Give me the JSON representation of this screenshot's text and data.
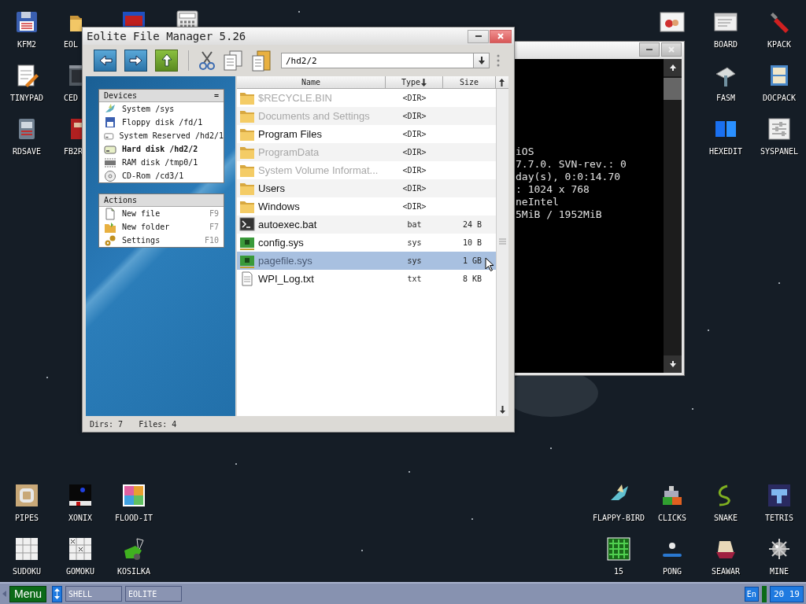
{
  "desktop": {
    "top_left": [
      [
        {
          "label": "KFM2"
        },
        {
          "label": "EOL"
        }
      ],
      [
        {
          "label": "TINYPAD"
        },
        {
          "label": "CED"
        }
      ],
      [
        {
          "label": "RDSAVE"
        },
        {
          "label": "FB2R"
        }
      ]
    ],
    "top_right": [
      [
        {
          "label": "BOARD"
        },
        {
          "label": "KPACK"
        }
      ],
      [
        {
          "label": "FASM"
        },
        {
          "label": "DOCPACK"
        }
      ],
      [
        {
          "label": "HEXEDIT"
        },
        {
          "label": "SYSPANEL"
        }
      ]
    ],
    "bottom_left": [
      [
        {
          "label": "PIPES"
        },
        {
          "label": "XONIX"
        },
        {
          "label": "FLOOD-IT"
        }
      ],
      [
        {
          "label": "SUDOKU"
        },
        {
          "label": "GOMOKU"
        },
        {
          "label": "KOSILKA"
        }
      ]
    ],
    "bottom_right": [
      [
        {
          "label": "FLAPPY-BIRD"
        },
        {
          "label": "CLICKS"
        },
        {
          "label": "SNAKE"
        },
        {
          "label": "TETRIS"
        }
      ],
      [
        {
          "label": "15"
        },
        {
          "label": "PONG"
        },
        {
          "label": "SEAWAR"
        },
        {
          "label": "MINE"
        }
      ]
    ]
  },
  "terminal": {
    "lines": [
      "iOS",
      "7.7.0. SVN-rev.: 0",
      "day(s), 0:0:14.70",
      ": 1024 x 768",
      "neIntel",
      "5MiB / 1952MiB"
    ]
  },
  "file_manager": {
    "title": "Eolite File Manager 5.26",
    "path": "/hd2/2",
    "devices": {
      "title": "Devices",
      "menu_symbol": "=",
      "items": [
        {
          "label": "System /sys",
          "selected": false
        },
        {
          "label": "Floppy disk /fd/1",
          "selected": false
        },
        {
          "label": "System Reserved /hd2/1",
          "selected": false
        },
        {
          "label": "Hard disk /hd2/2",
          "selected": true
        },
        {
          "label": "RAM disk /tmp0/1",
          "selected": false
        },
        {
          "label": "CD-Rom /cd3/1",
          "selected": false
        }
      ]
    },
    "actions": {
      "title": "Actions",
      "items": [
        {
          "label": "New file",
          "shortcut": "F9"
        },
        {
          "label": "New folder",
          "shortcut": "F7"
        },
        {
          "label": "Settings",
          "shortcut": "F10"
        }
      ]
    },
    "columns": [
      {
        "label": "Name",
        "sorted": false
      },
      {
        "label": "Type",
        "sorted": true
      },
      {
        "label": "Size",
        "sorted": false
      }
    ],
    "files": [
      {
        "name": "$RECYCLE.BIN",
        "type": "<DIR>",
        "kind": "folder",
        "hidden": true,
        "selected": false
      },
      {
        "name": "Documents and Settings",
        "type": "<DIR>",
        "kind": "folder",
        "hidden": true,
        "selected": false
      },
      {
        "name": "Program Files",
        "type": "<DIR>",
        "kind": "folder",
        "hidden": false,
        "selected": false
      },
      {
        "name": "ProgramData",
        "type": "<DIR>",
        "kind": "folder",
        "hidden": true,
        "selected": false
      },
      {
        "name": "System Volume Informat...",
        "type": "<DIR>",
        "kind": "folder",
        "hidden": true,
        "selected": false
      },
      {
        "name": "Users",
        "type": "<DIR>",
        "kind": "folder",
        "hidden": false,
        "selected": false
      },
      {
        "name": "Windows",
        "type": "<DIR>",
        "kind": "folder",
        "hidden": false,
        "selected": false
      },
      {
        "name": "autoexec.bat",
        "type": "bat",
        "size": "24 B",
        "kind": "script",
        "hidden": false,
        "selected": false
      },
      {
        "name": "config.sys",
        "type": "sys",
        "size": "10 B",
        "kind": "system",
        "hidden": false,
        "selected": false
      },
      {
        "name": "pagefile.sys",
        "type": "sys",
        "size": "1 GB",
        "kind": "system",
        "hidden": true,
        "selected": true
      },
      {
        "name": "WPI_Log.txt",
        "type": "txt",
        "size": "8 KB",
        "kind": "text",
        "hidden": false,
        "selected": false
      }
    ],
    "status": [
      "Dirs: 7",
      "Files: 4"
    ]
  },
  "taskbar": {
    "menu": "Menu",
    "tasks": [
      {
        "label": "SHELL"
      },
      {
        "label": "EOLITE"
      }
    ],
    "language": "En",
    "clock": "20 19"
  }
}
